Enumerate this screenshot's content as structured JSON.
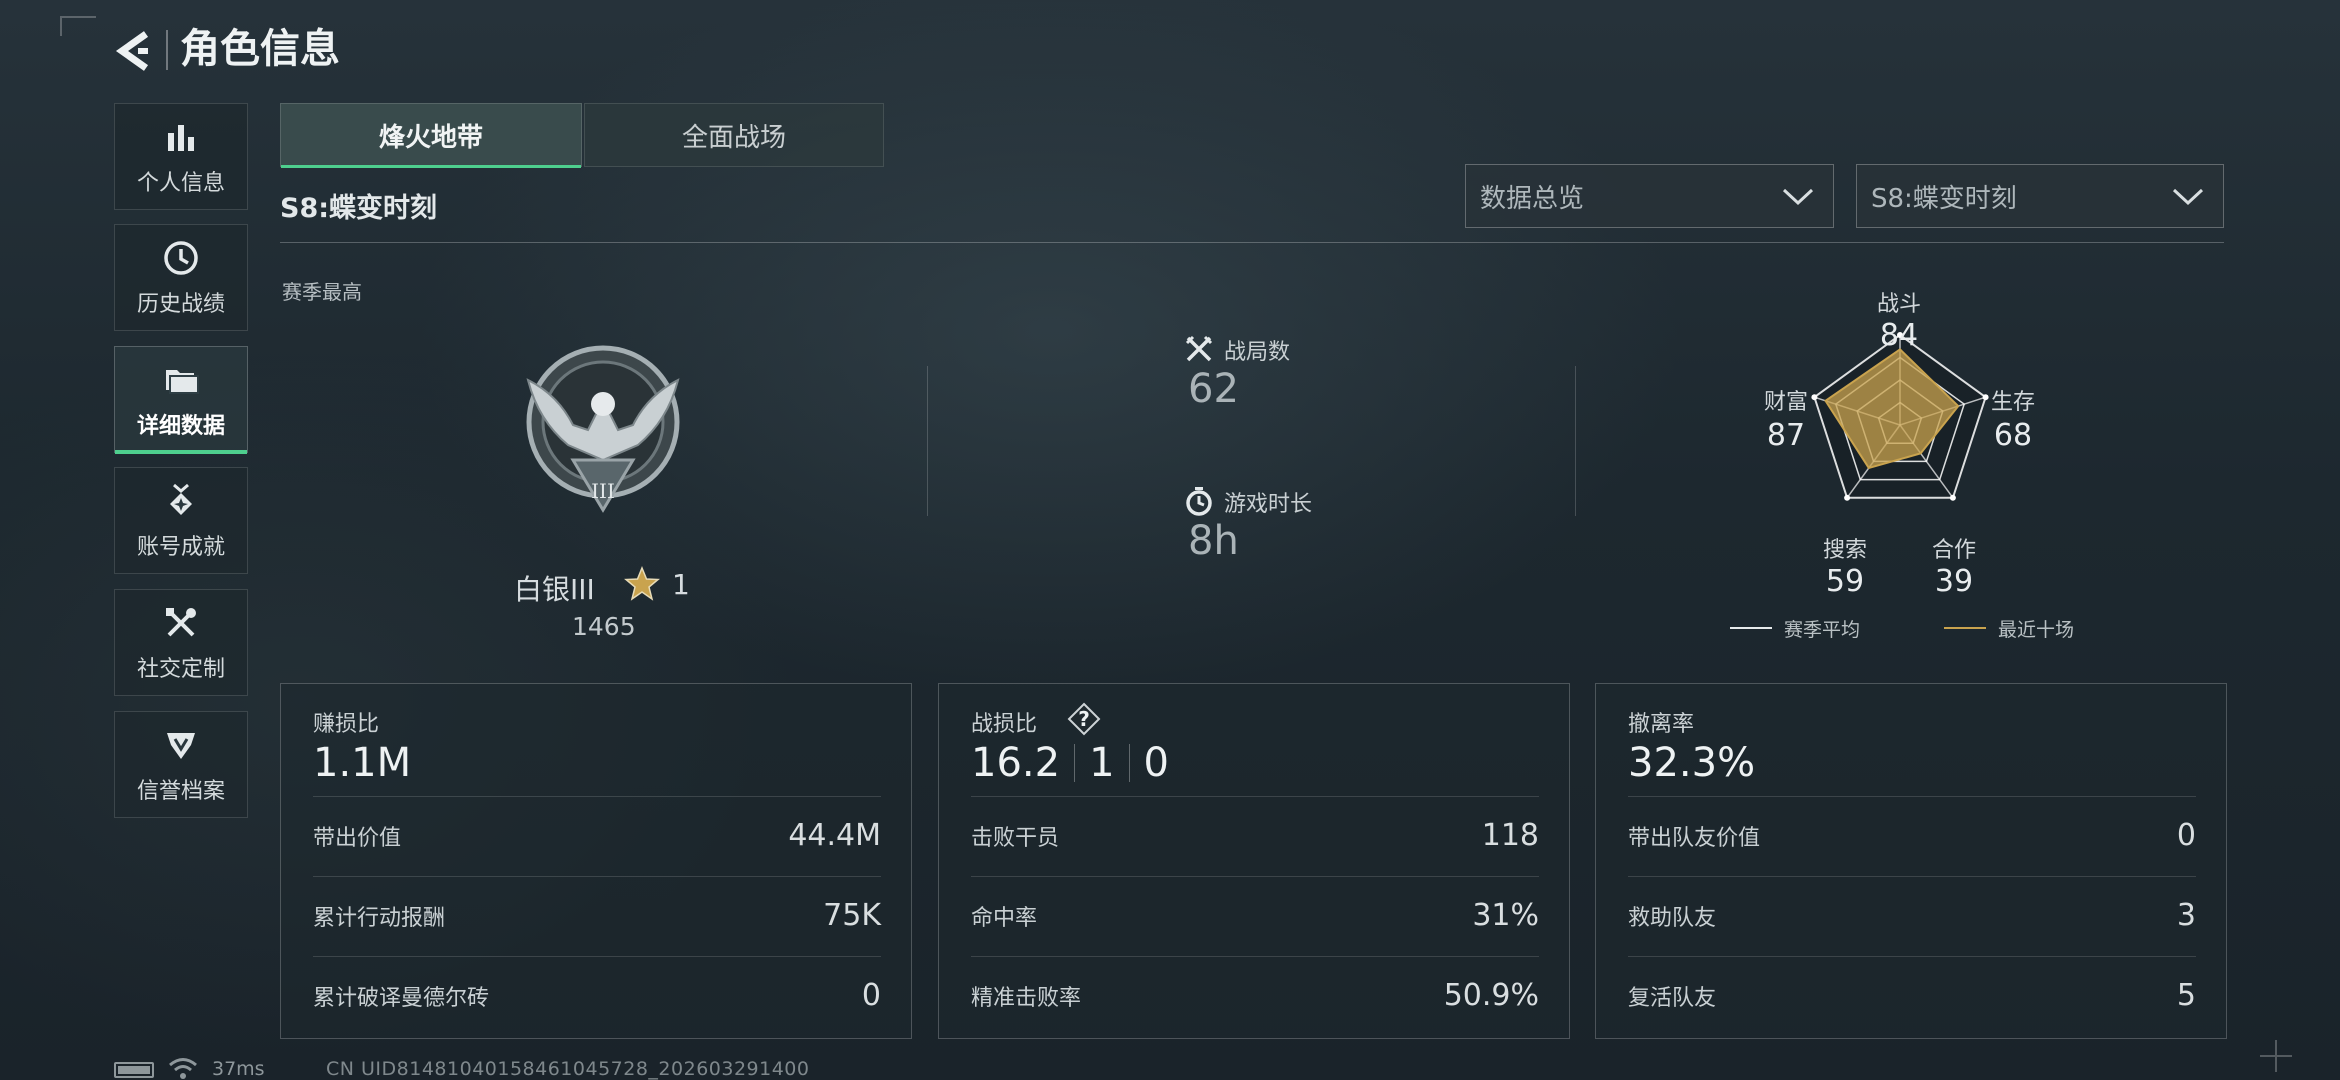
{
  "header": {
    "title": "角色信息"
  },
  "sidebar": {
    "items": [
      {
        "label": "个人信息",
        "icon": "bar-chart-icon",
        "active": false
      },
      {
        "label": "历史战绩",
        "icon": "clock-icon",
        "active": false
      },
      {
        "label": "详细数据",
        "icon": "folder-icon",
        "active": true
      },
      {
        "label": "账号成就",
        "icon": "medal-icon",
        "active": false
      },
      {
        "label": "社交定制",
        "icon": "tools-icon",
        "active": false
      },
      {
        "label": "信誉档案",
        "icon": "shield-wings-icon",
        "active": false
      }
    ]
  },
  "tabs": [
    {
      "label": "烽火地带",
      "active": true
    },
    {
      "label": "全面战场",
      "active": false
    }
  ],
  "season_title": "S8:蝶变时刻",
  "filters": {
    "mode": "数据总览",
    "season": "S8:蝶变时刻"
  },
  "season_best": "赛季最高",
  "rank": {
    "name": "白银III",
    "stars": "1",
    "points": "1465",
    "badge_numeral": "III"
  },
  "stats": {
    "matches_label": "战局数",
    "matches_value": "62",
    "playtime_label": "游戏时长",
    "playtime_value": "8h"
  },
  "radar": {
    "labels": {
      "combat": "战斗",
      "survival": "生存",
      "cooperation": "合作",
      "search": "搜索",
      "wealth": "财富"
    },
    "values": {
      "combat": "84",
      "survival": "68",
      "cooperation": "39",
      "search": "59",
      "wealth": "87"
    },
    "legend": {
      "season_avg": "赛季平均",
      "recent_ten": "最近十场"
    },
    "colors": {
      "season_avg": "#e6eaeb",
      "recent_ten": "#c9a34e"
    }
  },
  "panels": {
    "profit": {
      "label": "赚损比",
      "value": "1.1M",
      "rows": [
        {
          "label": "带出价值",
          "value": "44.4M"
        },
        {
          "label": "累计行动报酬",
          "value": "75K"
        },
        {
          "label": "累计破译曼德尔砖",
          "value": "0"
        }
      ]
    },
    "combat": {
      "label": "战损比",
      "help": "?",
      "kda": [
        "16.2",
        "1",
        "0"
      ],
      "rows": [
        {
          "label": "击败干员",
          "value": "118"
        },
        {
          "label": "命中率",
          "value": "31%"
        },
        {
          "label": "精准击败率",
          "value": "50.9%"
        }
      ]
    },
    "extract": {
      "label": "撤离率",
      "value": "32.3%",
      "rows": [
        {
          "label": "带出队友价值",
          "value": "0"
        },
        {
          "label": "救助队友",
          "value": "3"
        },
        {
          "label": "复活队友",
          "value": "5"
        }
      ]
    }
  },
  "footer": {
    "ping": "37ms",
    "uid": "CN UID8148104015846104572​8_202603291400"
  },
  "accent": "#4ecf8e"
}
